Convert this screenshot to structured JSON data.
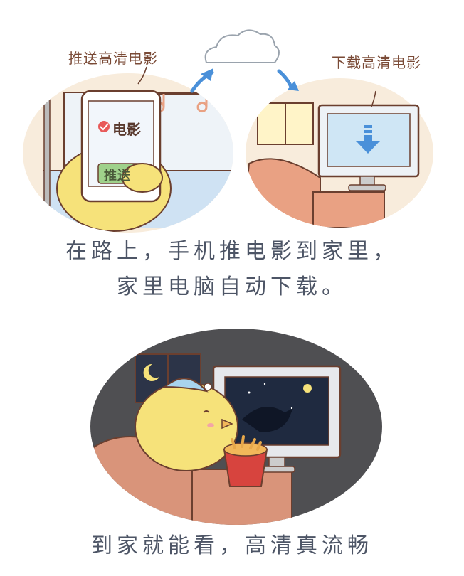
{
  "panel_top_left": {
    "label": "推送高清电影",
    "phone_title": "电影",
    "push_button": "推送"
  },
  "panel_top_right": {
    "label": "下载高清电影"
  },
  "caption_1": {
    "line1": "在路上，手机推电影到家里，",
    "line2": "家里电脑自动下载。"
  },
  "caption_2": {
    "line1": "到家就能看，高清真流畅"
  },
  "colors": {
    "outline": "#6b3f2f",
    "chick": "#f6e27a",
    "sofa": "#e9a183",
    "sky_blue": "#4a90d9",
    "night_bg": "#5a5a5e"
  }
}
